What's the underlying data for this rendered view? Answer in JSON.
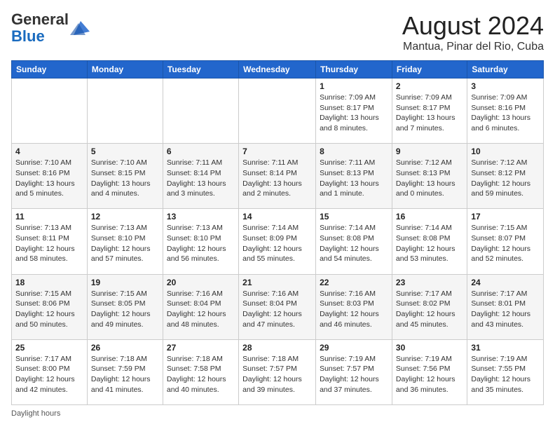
{
  "header": {
    "logo_line1": "General",
    "logo_line2": "Blue",
    "month_year": "August 2024",
    "location": "Mantua, Pinar del Rio, Cuba"
  },
  "days_of_week": [
    "Sunday",
    "Monday",
    "Tuesday",
    "Wednesday",
    "Thursday",
    "Friday",
    "Saturday"
  ],
  "weeks": [
    [
      {
        "day": "",
        "info": ""
      },
      {
        "day": "",
        "info": ""
      },
      {
        "day": "",
        "info": ""
      },
      {
        "day": "",
        "info": ""
      },
      {
        "day": "1",
        "info": "Sunrise: 7:09 AM\nSunset: 8:17 PM\nDaylight: 13 hours\nand 8 minutes."
      },
      {
        "day": "2",
        "info": "Sunrise: 7:09 AM\nSunset: 8:17 PM\nDaylight: 13 hours\nand 7 minutes."
      },
      {
        "day": "3",
        "info": "Sunrise: 7:09 AM\nSunset: 8:16 PM\nDaylight: 13 hours\nand 6 minutes."
      }
    ],
    [
      {
        "day": "4",
        "info": "Sunrise: 7:10 AM\nSunset: 8:16 PM\nDaylight: 13 hours\nand 5 minutes."
      },
      {
        "day": "5",
        "info": "Sunrise: 7:10 AM\nSunset: 8:15 PM\nDaylight: 13 hours\nand 4 minutes."
      },
      {
        "day": "6",
        "info": "Sunrise: 7:11 AM\nSunset: 8:14 PM\nDaylight: 13 hours\nand 3 minutes."
      },
      {
        "day": "7",
        "info": "Sunrise: 7:11 AM\nSunset: 8:14 PM\nDaylight: 13 hours\nand 2 minutes."
      },
      {
        "day": "8",
        "info": "Sunrise: 7:11 AM\nSunset: 8:13 PM\nDaylight: 13 hours\nand 1 minute."
      },
      {
        "day": "9",
        "info": "Sunrise: 7:12 AM\nSunset: 8:13 PM\nDaylight: 13 hours\nand 0 minutes."
      },
      {
        "day": "10",
        "info": "Sunrise: 7:12 AM\nSunset: 8:12 PM\nDaylight: 12 hours\nand 59 minutes."
      }
    ],
    [
      {
        "day": "11",
        "info": "Sunrise: 7:13 AM\nSunset: 8:11 PM\nDaylight: 12 hours\nand 58 minutes."
      },
      {
        "day": "12",
        "info": "Sunrise: 7:13 AM\nSunset: 8:10 PM\nDaylight: 12 hours\nand 57 minutes."
      },
      {
        "day": "13",
        "info": "Sunrise: 7:13 AM\nSunset: 8:10 PM\nDaylight: 12 hours\nand 56 minutes."
      },
      {
        "day": "14",
        "info": "Sunrise: 7:14 AM\nSunset: 8:09 PM\nDaylight: 12 hours\nand 55 minutes."
      },
      {
        "day": "15",
        "info": "Sunrise: 7:14 AM\nSunset: 8:08 PM\nDaylight: 12 hours\nand 54 minutes."
      },
      {
        "day": "16",
        "info": "Sunrise: 7:14 AM\nSunset: 8:08 PM\nDaylight: 12 hours\nand 53 minutes."
      },
      {
        "day": "17",
        "info": "Sunrise: 7:15 AM\nSunset: 8:07 PM\nDaylight: 12 hours\nand 52 minutes."
      }
    ],
    [
      {
        "day": "18",
        "info": "Sunrise: 7:15 AM\nSunset: 8:06 PM\nDaylight: 12 hours\nand 50 minutes."
      },
      {
        "day": "19",
        "info": "Sunrise: 7:15 AM\nSunset: 8:05 PM\nDaylight: 12 hours\nand 49 minutes."
      },
      {
        "day": "20",
        "info": "Sunrise: 7:16 AM\nSunset: 8:04 PM\nDaylight: 12 hours\nand 48 minutes."
      },
      {
        "day": "21",
        "info": "Sunrise: 7:16 AM\nSunset: 8:04 PM\nDaylight: 12 hours\nand 47 minutes."
      },
      {
        "day": "22",
        "info": "Sunrise: 7:16 AM\nSunset: 8:03 PM\nDaylight: 12 hours\nand 46 minutes."
      },
      {
        "day": "23",
        "info": "Sunrise: 7:17 AM\nSunset: 8:02 PM\nDaylight: 12 hours\nand 45 minutes."
      },
      {
        "day": "24",
        "info": "Sunrise: 7:17 AM\nSunset: 8:01 PM\nDaylight: 12 hours\nand 43 minutes."
      }
    ],
    [
      {
        "day": "25",
        "info": "Sunrise: 7:17 AM\nSunset: 8:00 PM\nDaylight: 12 hours\nand 42 minutes."
      },
      {
        "day": "26",
        "info": "Sunrise: 7:18 AM\nSunset: 7:59 PM\nDaylight: 12 hours\nand 41 minutes."
      },
      {
        "day": "27",
        "info": "Sunrise: 7:18 AM\nSunset: 7:58 PM\nDaylight: 12 hours\nand 40 minutes."
      },
      {
        "day": "28",
        "info": "Sunrise: 7:18 AM\nSunset: 7:57 PM\nDaylight: 12 hours\nand 39 minutes."
      },
      {
        "day": "29",
        "info": "Sunrise: 7:19 AM\nSunset: 7:57 PM\nDaylight: 12 hours\nand 37 minutes."
      },
      {
        "day": "30",
        "info": "Sunrise: 7:19 AM\nSunset: 7:56 PM\nDaylight: 12 hours\nand 36 minutes."
      },
      {
        "day": "31",
        "info": "Sunrise: 7:19 AM\nSunset: 7:55 PM\nDaylight: 12 hours\nand 35 minutes."
      }
    ]
  ],
  "footer": {
    "note": "Daylight hours"
  }
}
